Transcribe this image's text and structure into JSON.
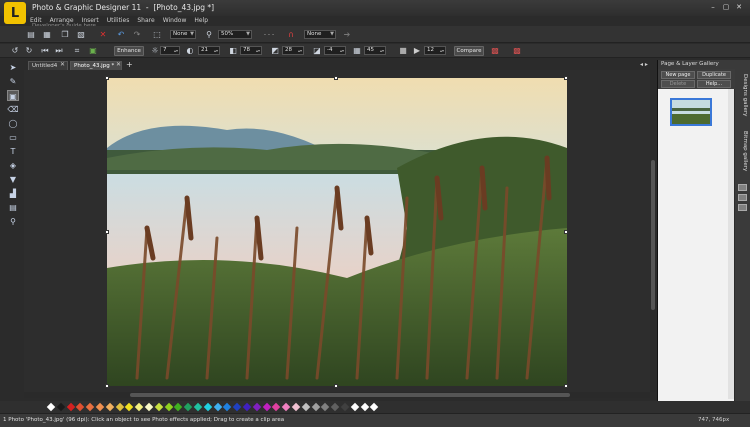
{
  "window": {
    "app_title": "Photo & Graphic Designer 11",
    "document_title": "[Photo_43.jpg *]",
    "app_icon_letter": "L"
  },
  "menu": {
    "items": [
      "Edit",
      "Arrange",
      "Insert",
      "Utilities",
      "Share",
      "Window",
      "Help"
    ],
    "ghost_tooltip": "Developer's guide here"
  },
  "toolbar1": {
    "selection_value": "None",
    "zoom_value": "50%",
    "feather_value": "None"
  },
  "toolbar2": {
    "enhance_label": "Enhance",
    "brightness": "7",
    "contrast": "21",
    "saturation": "78",
    "temperature": "28",
    "tint": "-4",
    "blur": "45",
    "play_value": "12",
    "compare_label": "Compare"
  },
  "tabs": [
    {
      "label": "Untitled4",
      "active": false
    },
    {
      "label": "Photo_43.jpg *",
      "active": true
    }
  ],
  "gallery": {
    "title": "Page & Layer Gallery",
    "new_page": "New page",
    "duplicate": "Duplicate",
    "delete": "Delete",
    "help": "Help..."
  },
  "side_tabs": [
    "Designs gallery",
    "Bitmap gallery"
  ],
  "status": {
    "text": "1 Photo 'Photo_43.jpg' (96 dpi): Click an object to see Photo effects applied; Drag to create a clip area",
    "coords": "747, 746px"
  },
  "palette_colors": [
    "#ffffff",
    "#1a1a1a",
    "#d42020",
    "#e05030",
    "#e87040",
    "#f09050",
    "#f0b060",
    "#e0c040",
    "#f0e020",
    "#f4f080",
    "#fafac8",
    "#c8e040",
    "#90d020",
    "#40b020",
    "#20a060",
    "#20c0a0",
    "#20d0e0",
    "#40b0f0",
    "#2080e0",
    "#2040c0",
    "#4020c0",
    "#8020c0",
    "#c020c0",
    "#e040a0",
    "#f080c0",
    "#f0c0d0",
    "#c0c0c0",
    "#a0a0a0",
    "#808080",
    "#606060",
    "#404040",
    "#ffffff",
    "#ffffff",
    "#ffffff"
  ]
}
